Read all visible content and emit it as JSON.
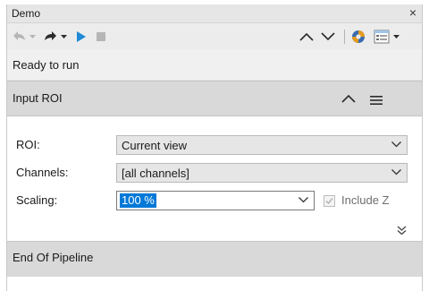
{
  "window": {
    "title": "Demo",
    "close_glyph": "×"
  },
  "toolbar": {
    "buttons": [
      {
        "icon": "undo-arrow-icon",
        "enabled": false,
        "has_dropdown": true
      },
      {
        "icon": "redo-arrow-icon",
        "enabled": true,
        "has_dropdown": true
      },
      {
        "icon": "play-icon",
        "enabled": true
      },
      {
        "icon": "stop-icon",
        "enabled": false
      },
      {
        "icon": "chevron-up-icon",
        "enabled": true
      },
      {
        "icon": "chevron-down-icon",
        "enabled": true
      },
      {
        "icon": "settings-gear-icon",
        "enabled": true
      },
      {
        "icon": "view-options-icon",
        "enabled": true,
        "has_dropdown": true
      }
    ]
  },
  "status": {
    "text": "Ready to run"
  },
  "input_roi": {
    "title": "Input ROI",
    "fields": {
      "roi": {
        "label": "ROI:",
        "value": "Current view"
      },
      "channels": {
        "label": "Channels:",
        "value": "[all channels]"
      },
      "scaling": {
        "label": "Scaling:",
        "value": "100 %"
      }
    },
    "include_z": {
      "label": "Include Z",
      "checked": true,
      "enabled": false
    }
  },
  "end_of_pipeline": {
    "title": "End Of Pipeline"
  },
  "colors": {
    "accent_blue": "#0078d7",
    "header_gray": "#d9d9d9",
    "toolbar_gray": "#ececec",
    "select_gray": "#e6e6e6"
  }
}
